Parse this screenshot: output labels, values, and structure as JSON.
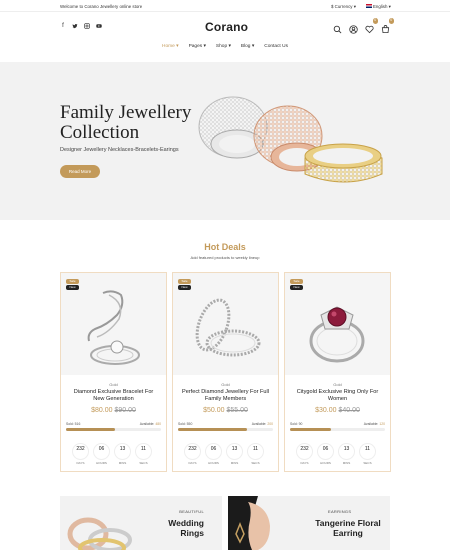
{
  "topbar": {
    "welcome": "Welcome to Corano Jewellery online store",
    "currency": "$ Currency",
    "language": "English"
  },
  "header": {
    "logo_text": "Corano",
    "social_icons": [
      "facebook-icon",
      "twitter-icon",
      "instagram-icon",
      "youtube-icon"
    ],
    "icons": [
      "search-icon",
      "user-icon",
      "heart-icon",
      "cart-icon"
    ],
    "wishlist_count": "0",
    "cart_count": "0"
  },
  "nav": [
    {
      "label": "Home",
      "active": true
    },
    {
      "label": "Pages",
      "active": false
    },
    {
      "label": "Shop",
      "active": false
    },
    {
      "label": "Blog",
      "active": false
    },
    {
      "label": "Contact Us",
      "active": false
    }
  ],
  "hero": {
    "title_line1": "Family Jewellery",
    "title_line2": "Collection",
    "subtitle": "Designer Jewellery Necklaces-Bracelets-Earings",
    "button": "Read More"
  },
  "deals": {
    "title": "Hot Deals",
    "subtitle": "Add featured products to weekly lineup"
  },
  "products": [
    {
      "category": "Gold",
      "name": "Diamond Exclusive Bracelet For New Generation",
      "price": "$80.00",
      "old_price": "$90.00",
      "sold": "Sold: 516",
      "available_label": "Available:",
      "available": "480",
      "sold_ratio": 0.52,
      "timer": {
        "days": "232",
        "hours": "06",
        "mins": "13",
        "secs": "11"
      }
    },
    {
      "category": "Gold",
      "name": "Perfect Diamond Jewellery For Full Family Members",
      "price": "$50.00",
      "old_price": "$55.00",
      "sold": "Sold: 550",
      "available_label": "Available:",
      "available": "200",
      "sold_ratio": 0.73,
      "timer": {
        "days": "232",
        "hours": "06",
        "mins": "13",
        "secs": "11"
      }
    },
    {
      "category": "Gold",
      "name": "Citygold Exclusive Ring Only For Women",
      "price": "$30.00",
      "old_price": "$40.00",
      "sold": "Sold: 90",
      "available_label": "Available:",
      "available": "120",
      "sold_ratio": 0.43,
      "timer": {
        "days": "232",
        "hours": "06",
        "mins": "13",
        "secs": "11"
      }
    }
  ],
  "timer_labels": {
    "days": "DAYS",
    "hours": "HOURS",
    "mins": "MINS",
    "secs": "SECS"
  },
  "badges": {
    "sale": "Sale",
    "new": "New"
  },
  "banners": [
    {
      "kicker": "BEAUTIFUL",
      "title_line1": "Wedding",
      "title_line2": "Rings"
    },
    {
      "kicker": "EARRINGS",
      "title_line1": "Tangerine Floral",
      "title_line2": "Earring"
    }
  ],
  "colors": {
    "accent": "#c39a5a",
    "background": "#f2f2f2"
  }
}
